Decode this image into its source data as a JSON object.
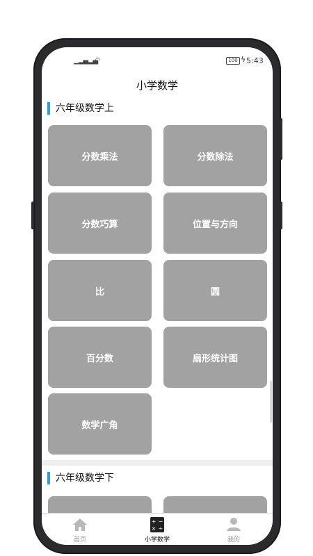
{
  "status": {
    "signal1": "𝄃ıl",
    "signal2": "𝄃ıl",
    "battery": "100",
    "time": "5:43"
  },
  "app": {
    "title": "小学数学"
  },
  "sections": [
    {
      "title": "六年级数学上",
      "items": [
        "分数乘法",
        "分数除法",
        "分数巧算",
        "位置与方向",
        "比",
        "圆",
        "百分数",
        "扇形统计图",
        "数学广角"
      ]
    },
    {
      "title": "六年级数学下",
      "items": [
        "",
        ""
      ]
    }
  ],
  "tabs": [
    {
      "label": "首页",
      "icon": "home-icon"
    },
    {
      "label": "小学数学",
      "icon": "calculator-icon"
    },
    {
      "label": "我的",
      "icon": "user-icon"
    }
  ],
  "colors": {
    "accent": "#2a9fd8",
    "tile": "#a2a2a2"
  }
}
